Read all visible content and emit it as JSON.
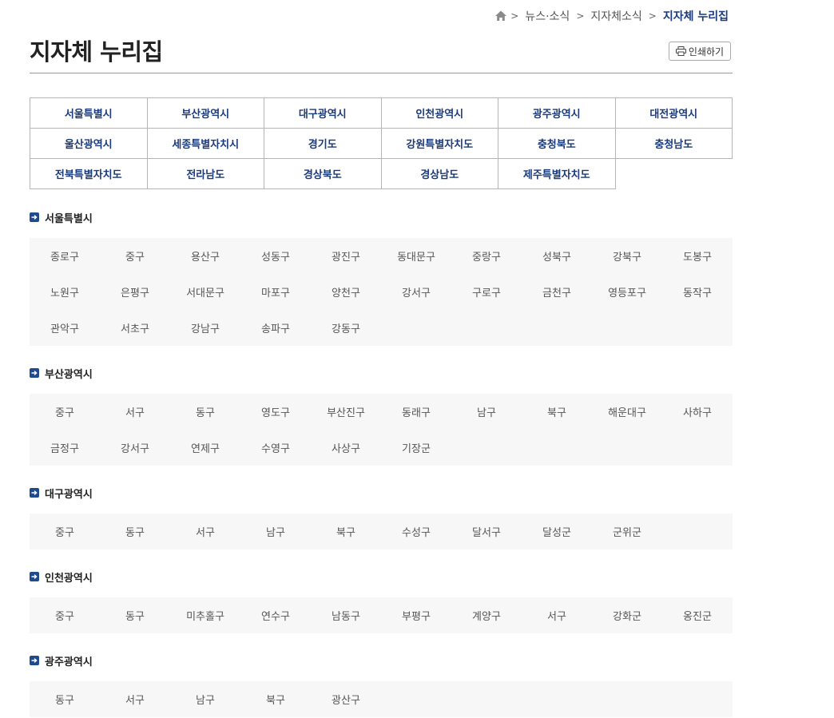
{
  "breadcrumb": {
    "items": [
      "뉴스·소식",
      "지자체소식"
    ],
    "current": "지자체 누리집",
    "separator": ">"
  },
  "page": {
    "title": "지자체 누리집",
    "print_label": "인쇄하기"
  },
  "regions": [
    "서울특별시",
    "부산광역시",
    "대구광역시",
    "인천광역시",
    "광주광역시",
    "대전광역시",
    "울산광역시",
    "세종특별자치시",
    "경기도",
    "강원특별자치도",
    "충청북도",
    "충청남도",
    "전북특별자치도",
    "전라남도",
    "경상북도",
    "경상남도",
    "제주특별자치도"
  ],
  "sections": [
    {
      "title": "서울특별시",
      "districts": [
        "종로구",
        "중구",
        "용산구",
        "성동구",
        "광진구",
        "동대문구",
        "중랑구",
        "성북구",
        "강북구",
        "도봉구",
        "노원구",
        "은평구",
        "서대문구",
        "마포구",
        "양천구",
        "강서구",
        "구로구",
        "금천구",
        "영등포구",
        "동작구",
        "관악구",
        "서초구",
        "강남구",
        "송파구",
        "강동구"
      ]
    },
    {
      "title": "부산광역시",
      "districts": [
        "중구",
        "서구",
        "동구",
        "영도구",
        "부산진구",
        "동래구",
        "남구",
        "북구",
        "해운대구",
        "사하구",
        "금정구",
        "강서구",
        "연제구",
        "수영구",
        "사상구",
        "기장군"
      ]
    },
    {
      "title": "대구광역시",
      "districts": [
        "중구",
        "동구",
        "서구",
        "남구",
        "북구",
        "수성구",
        "달서구",
        "달성군",
        "군위군"
      ]
    },
    {
      "title": "인천광역시",
      "districts": [
        "중구",
        "동구",
        "미추홀구",
        "연수구",
        "남동구",
        "부평구",
        "계양구",
        "서구",
        "강화군",
        "옹진군"
      ]
    },
    {
      "title": "광주광역시",
      "districts": [
        "동구",
        "서구",
        "남구",
        "북구",
        "광산구"
      ]
    }
  ],
  "colors": {
    "accent": "#1a3a7a",
    "box_bg": "#f7f7f7"
  }
}
